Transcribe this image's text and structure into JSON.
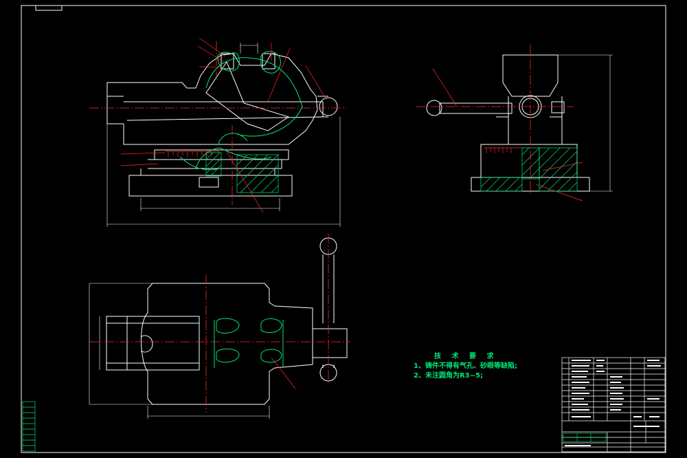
{
  "colors": {
    "background": "#000000",
    "frame": "#ffffff",
    "outline": "#00e676",
    "centerline": "#ff2a2a",
    "hidden": "#ff6a3d",
    "dimension": "#ffffff",
    "hatch": "#00e676",
    "leader": "#ff2a2a"
  },
  "technical_requirements": {
    "title": "技 术 要 求",
    "items": [
      "1、铸件不得有气孔、砂眼等缺陷;",
      "2、未注圆角为R3~5;"
    ]
  }
}
